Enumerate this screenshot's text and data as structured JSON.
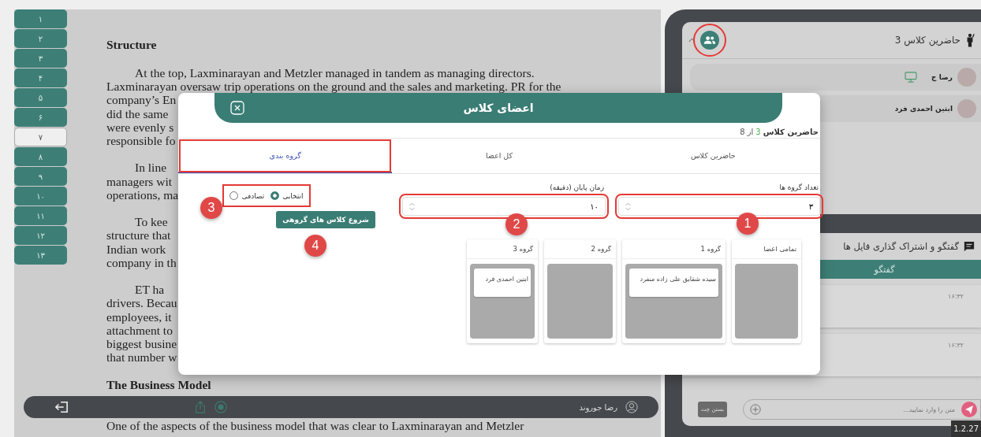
{
  "pager": [
    {
      "label": "۱",
      "selected": false
    },
    {
      "label": "۲",
      "selected": false
    },
    {
      "label": "۳",
      "selected": false
    },
    {
      "label": "۴",
      "selected": false
    },
    {
      "label": "۵",
      "selected": false
    },
    {
      "label": "۶",
      "selected": false
    },
    {
      "label": "۷",
      "selected": true
    },
    {
      "label": "۸",
      "selected": false
    },
    {
      "label": "۹",
      "selected": false
    },
    {
      "label": "۱۰",
      "selected": false
    },
    {
      "label": "۱۱",
      "selected": false
    },
    {
      "label": "۱۲",
      "selected": false
    },
    {
      "label": "۱۳",
      "selected": false
    }
  ],
  "document": {
    "heading": "Structure",
    "paragraphs": [
      [
        "At the top, Laxminarayan and Metzler managed in tandem as managing directors.",
        "Laxminarayan oversaw trip operations on the ground and the sales and marketing. PR for the",
        "company’s En",
        "did the same",
        "were evenly s",
        "responsible fo"
      ],
      [
        "In line",
        "managers wit",
        "operations, ma"
      ],
      [
        "To kee",
        "structure that",
        "Indian work",
        "company in th"
      ],
      [
        "ET ha",
        "drivers. Becau",
        "employees, it",
        "attachment to",
        "biggest busine",
        "that number w"
      ]
    ],
    "heading_2": "The Business Model",
    "last_line": "One of the aspects of the business model that was clear to Laxminarayan and Metzler"
  },
  "bottom_bar": {
    "user": "رضا جوروند"
  },
  "attendees_panel": {
    "title": "حاضرین کلاس 3",
    "members": [
      {
        "name": "رضا ج",
        "desktop": true
      },
      {
        "name": "ابتین احمدی فرد",
        "desktop": false
      }
    ]
  },
  "chat_panel": {
    "title": "گفتگو و اشتراک گذاری فایل ها",
    "tab": "گفتگو",
    "messages": [
      {
        "time": "۱۶:۳۲"
      },
      {
        "time": "۱۶:۳۲"
      }
    ],
    "close_button": "بستن چت",
    "input": {
      "placeholder": "متن را وارد نمایید..."
    }
  },
  "version": "1.2.27",
  "modal": {
    "title": "اعضای کلاس",
    "summary": {
      "label": "حاضرین کلاس",
      "count": "3",
      "total": "از 8"
    },
    "tabs": [
      {
        "label": "حاضرین کلاس",
        "selected": false
      },
      {
        "label": "کل اعضا",
        "selected": false
      },
      {
        "label": "گروه بندی",
        "selected": true
      }
    ],
    "group_count": {
      "label": "تعداد گروه ها",
      "value": "۳"
    },
    "end_time": {
      "label": "زمان پایان (دقیقه)",
      "value": "۱۰"
    },
    "mode_options": [
      {
        "label": "انتخابی",
        "selected": true
      },
      {
        "label": "تصادفی",
        "selected": false
      }
    ],
    "start_button": "شروع کلاس های گروهی",
    "groups": [
      {
        "title": "تمامی اعضا"
      },
      {
        "title": "گروه 1",
        "members": [
          "سیده شقایق علی زاده منفرد"
        ]
      },
      {
        "title": "گروه 2"
      },
      {
        "title": "گروه 3",
        "members": [
          "ابتین احمدی فرد"
        ]
      }
    ]
  },
  "annotations": [
    {
      "number": "1"
    },
    {
      "number": "2"
    },
    {
      "number": "3"
    },
    {
      "number": "4"
    }
  ]
}
